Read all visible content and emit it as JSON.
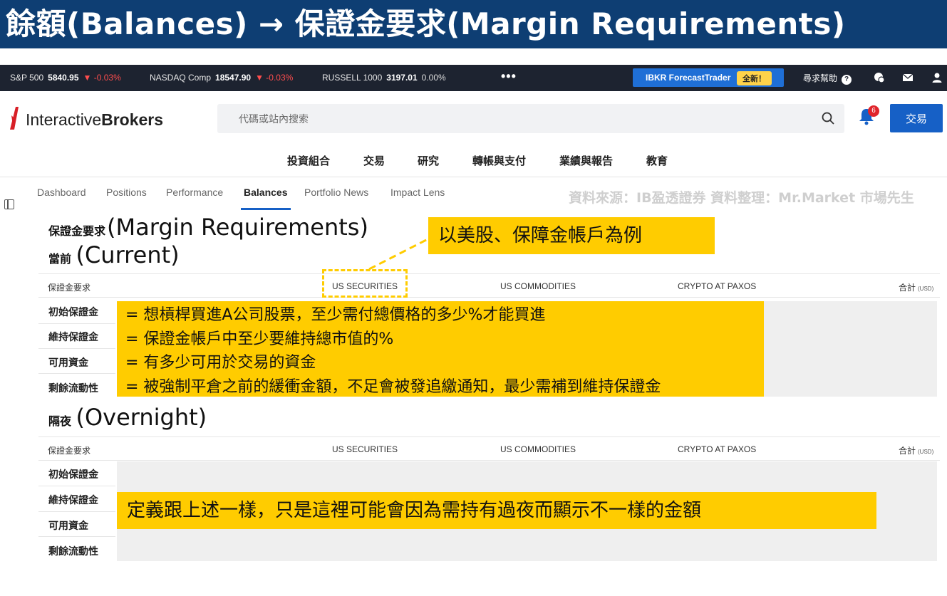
{
  "banner": {
    "title": "餘額(Balances) → 保證金要求(Margin Requirements)"
  },
  "ticker": {
    "items": [
      {
        "label": "S&P 500",
        "value": "5840.95",
        "change": "▼ -0.03%"
      },
      {
        "label": "NASDAQ Comp",
        "value": "18547.90",
        "change": "▼ -0.03%"
      },
      {
        "label": "RUSSELL 1000",
        "value": "3197.01",
        "change": "0.00%"
      }
    ],
    "more": "•••",
    "forecast_trader": "IBKR ForecastTrader",
    "new_badge": "全新！",
    "help": "尋求幫助",
    "help_icon": "?"
  },
  "header": {
    "logo_light": "Interactive",
    "logo_bold": "Brokers",
    "search_placeholder": "代碼或站內搜索",
    "notification_count": "6",
    "trade_button": "交易"
  },
  "main_nav": [
    "投資組合",
    "交易",
    "研究",
    "轉帳與支付",
    "業績與報告",
    "教育"
  ],
  "sub_nav": {
    "tabs": [
      "Dashboard",
      "Positions",
      "Performance",
      "Balances",
      "Portfolio News",
      "Impact Lens"
    ],
    "active": "Balances"
  },
  "source_note": "資料來源：IB盈透證券   資料整理：Mr.Market 市場先生",
  "current": {
    "title_zh": "保證金要求",
    "title_en": "(Margin Requirements)",
    "subtitle_zh": "當前",
    "subtitle_en": "(Current)",
    "columns": [
      "保證金要求",
      "US SECURITIES",
      "US COMMODITIES",
      "CRYPTO AT PAXOS",
      "合計"
    ],
    "currency": "(USD)",
    "rows": [
      "初始保證金",
      "維持保證金",
      "可用資金",
      "剩餘流動性"
    ]
  },
  "overnight": {
    "title_zh": "隔夜",
    "title_en": "(Overnight)",
    "columns": [
      "保證金要求",
      "US SECURITIES",
      "US COMMODITIES",
      "CRYPTO AT PAXOS",
      "合計"
    ],
    "currency": "(USD)",
    "rows": [
      "初始保證金",
      "維持保證金",
      "可用資金",
      "剩餘流動性"
    ]
  },
  "annotations": {
    "example": "以美股、保障金帳戶為例",
    "definitions": [
      "= 想槓桿買進A公司股票，至少需付總價格的多少%才能買進",
      "= 保證金帳戶中至少要維持總市值的%",
      "= 有多少可用於交易的資金",
      "= 被強制平倉之前的緩衝金額，不足會被發追繳通知，最少需補到維持保證金"
    ],
    "overnight_note": "定義跟上述一樣，只是這裡可能會因為需持有過夜而顯示不一樣的金額"
  },
  "colors": {
    "banner": "#0e3e73",
    "ticker_bg": "#1d2330",
    "accent": "#1660c6",
    "highlight": "#ffcc00",
    "down": "#ff4d4d"
  }
}
